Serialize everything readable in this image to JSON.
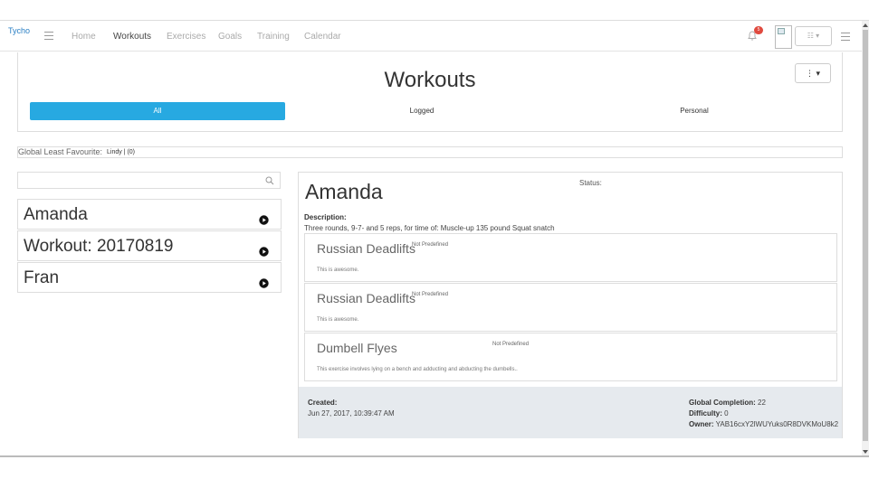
{
  "navbar": {
    "brand": "Tycho",
    "links": [
      {
        "label": "Home",
        "active": false
      },
      {
        "label": "Workouts",
        "active": true
      },
      {
        "label": "Exercises",
        "active": false
      },
      {
        "label": "Goals",
        "active": false
      },
      {
        "label": "Training",
        "active": false
      },
      {
        "label": "Calendar",
        "active": false
      }
    ],
    "notification_count": "5",
    "list_dropdown": "☷ ▾"
  },
  "header": {
    "title": "Workouts",
    "more_button": "⋮ ▾",
    "tabs": [
      {
        "label": "All",
        "active": true
      },
      {
        "label": "Logged",
        "active": false
      },
      {
        "label": "Personal",
        "active": false
      }
    ]
  },
  "global": {
    "label": "Global Least Favourite:",
    "value": "Lindy | (0)"
  },
  "search": {
    "placeholder": "",
    "value": ""
  },
  "workouts": [
    {
      "name": "Amanda"
    },
    {
      "name": "Workout: 20170819"
    },
    {
      "name": "Fran"
    }
  ],
  "detail": {
    "title": "Amanda",
    "status_label": "Status:",
    "description_label": "Description:",
    "description": "Three rounds, 9-7- and 5 reps, for time of: Muscle-up 135 pound Squat snatch",
    "exercises": [
      {
        "name": "Russian Deadlifts",
        "tag": "Not Predefined",
        "description": "This is awesome."
      },
      {
        "name": "Russian Deadlifts",
        "tag": "Not Predefined",
        "description": "This is awesome."
      },
      {
        "name": "Dumbell Flyes",
        "tag": "Not Predefined",
        "description": "This exercise involves lying on a bench and adducting and abducting the dumbells.."
      }
    ],
    "footer": {
      "created_label": "Created:",
      "created_value": "Jun 27, 2017, 10:39:47 AM",
      "completion_label": "Global Completion:",
      "completion_value": "22",
      "difficulty_label": "Difficulty:",
      "difficulty_value": "0",
      "owner_label": "Owner:",
      "owner_value": "YAB16cxY2lWUYuks0R8DVKMoU8k2"
    }
  },
  "colors": {
    "accent": "#27a9e1",
    "brand": "#2a7fc4",
    "badge": "#e04a3f",
    "footer_bg": "#e6eaee"
  }
}
